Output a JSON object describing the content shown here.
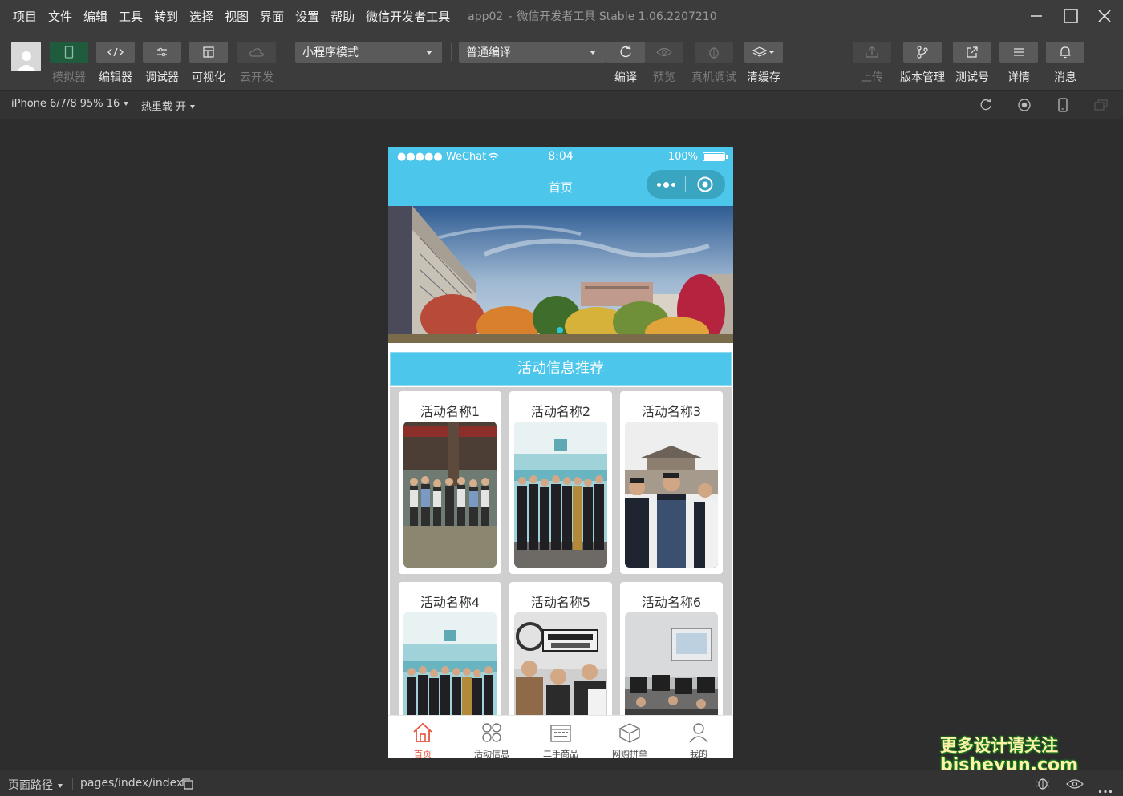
{
  "menu": [
    "项目",
    "文件",
    "编辑",
    "工具",
    "转到",
    "选择",
    "视图",
    "界面",
    "设置",
    "帮助",
    "微信开发者工具"
  ],
  "window_title": {
    "project": "app02",
    "separator": "-",
    "app": "微信开发者工具 Stable 1.06.2207210"
  },
  "toolbar": {
    "simulator": "模拟器",
    "editor": "编辑器",
    "debugger": "调试器",
    "visual": "可视化",
    "cloud": "云开发",
    "mode_select": "小程序模式",
    "compile_select": "普通编译",
    "compile": "编译",
    "preview": "预览",
    "remote_debug": "真机调试",
    "clear_cache": "清缓存",
    "upload": "上传",
    "version": "版本管理",
    "test_account": "测试号",
    "details": "详情",
    "messages": "消息"
  },
  "subbar": {
    "device": "iPhone 6/7/8 95% 16",
    "hot_reload": "热重载 开"
  },
  "phone": {
    "carrier": "●●●●● WeChat",
    "time": "8:04",
    "battery": "100%",
    "nav_title": "首页",
    "section_title": "活动信息推荐",
    "cards": [
      "活动名称1",
      "活动名称2",
      "活动名称3",
      "活动名称4",
      "活动名称5",
      "活动名称6"
    ],
    "tabs": [
      "首页",
      "活动信息",
      "二手商品",
      "网购拼单",
      "我的"
    ]
  },
  "bottombar": {
    "page_path_label": "页面路径",
    "page_path": "pages/index/index"
  },
  "watermark": {
    "line1": "更多设计请关注",
    "line2": "bisheyun.com"
  },
  "colors": {
    "accent": "#4cc6ea",
    "active_tab": "#e8543f",
    "bg_dark": "#2d2d2d"
  }
}
